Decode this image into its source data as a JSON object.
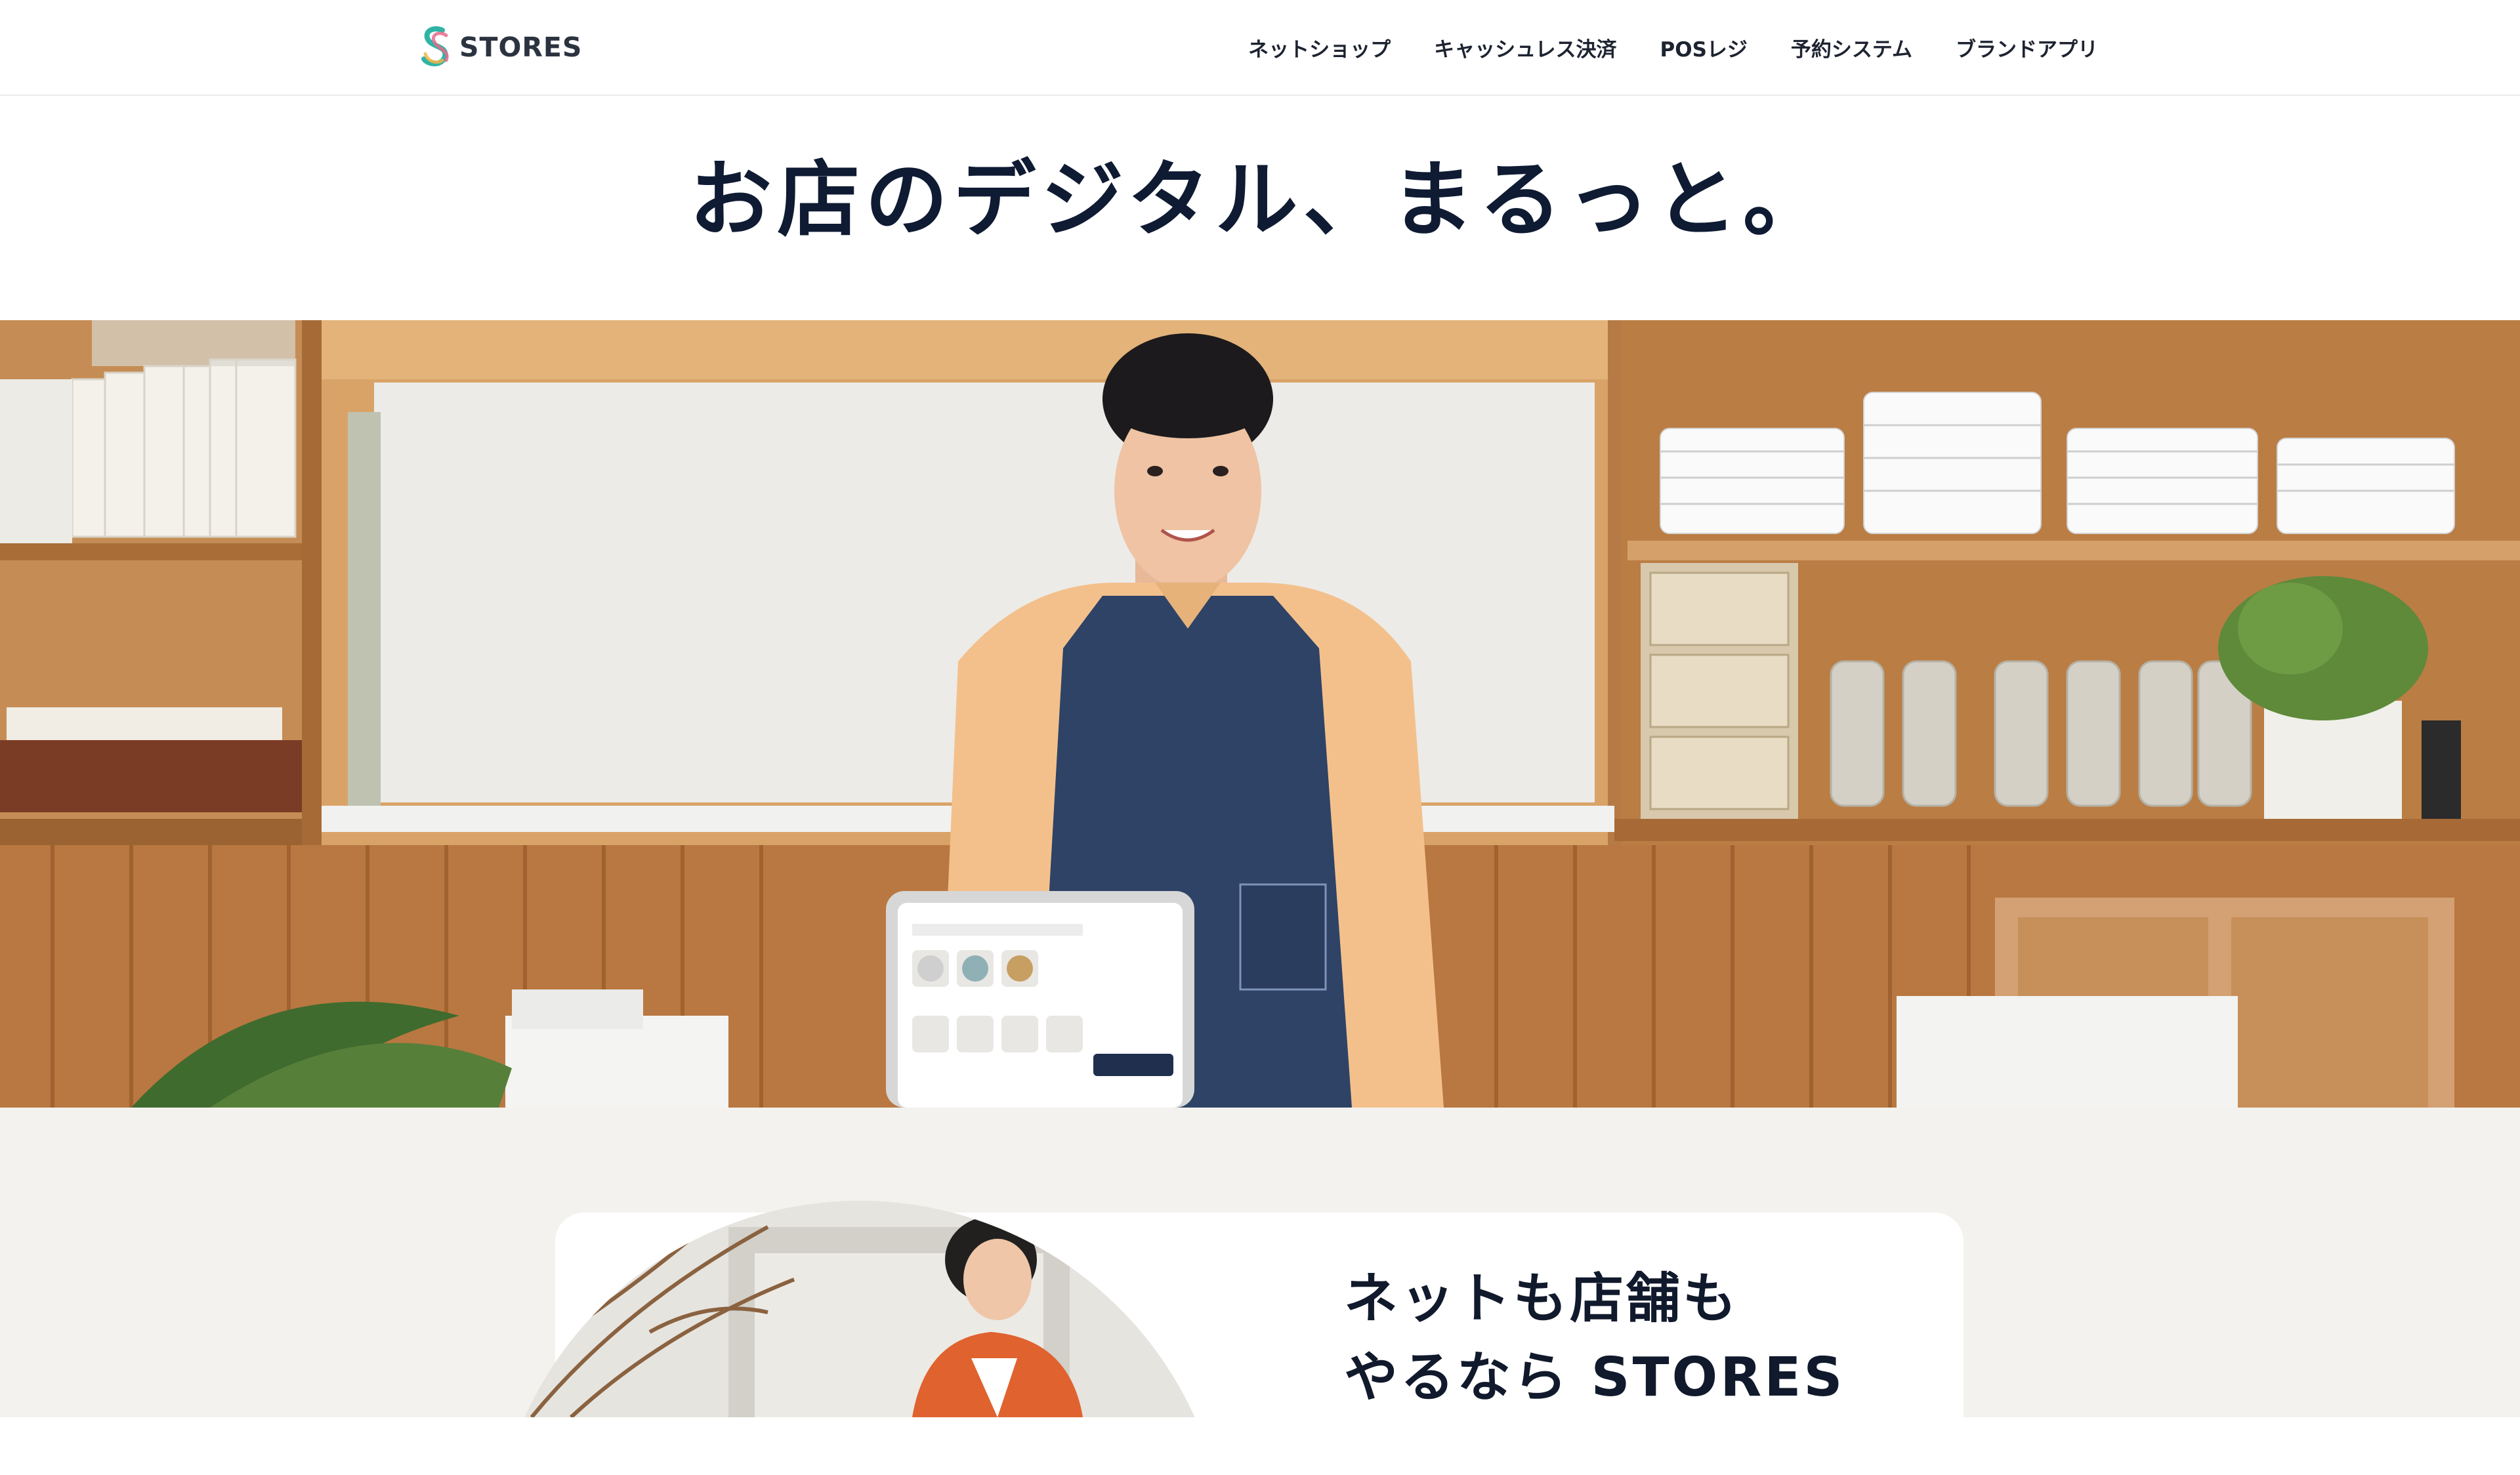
{
  "header": {
    "logo_text": "STORES",
    "nav": [
      {
        "label": "ネットショップ"
      },
      {
        "label": "キャッシュレス決済"
      },
      {
        "label": "POSレジ"
      },
      {
        "label": "予約システム"
      },
      {
        "label": "ブランドアプリ"
      }
    ]
  },
  "hero": {
    "title": "お店のデジタル、まるっと。"
  },
  "feature": {
    "heading_line1": "ネットも店舗も",
    "heading_line2": "やるなら STORES"
  },
  "colors": {
    "text_dark": "#0f1b33",
    "section_bg": "#f3f2ee",
    "card_bg": "#ffffff",
    "logo_teal": "#2fb3a6",
    "logo_pink": "#e86a8a"
  }
}
